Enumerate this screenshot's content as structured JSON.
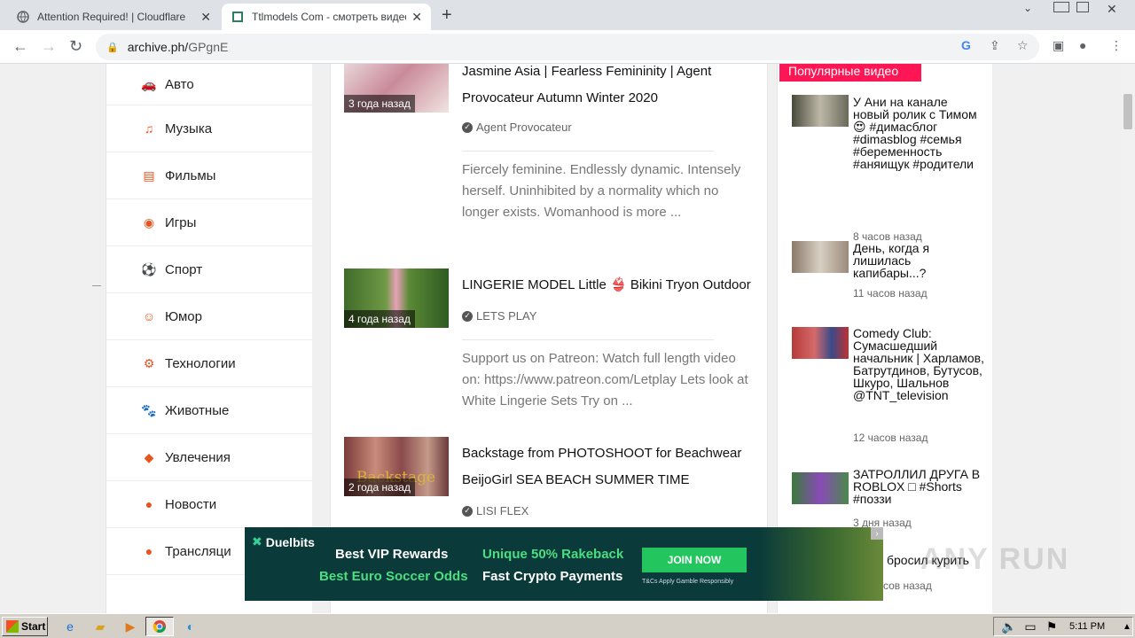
{
  "browser": {
    "tabs": [
      {
        "title": "Attention Required! | Cloudflare",
        "favicon": "globe-icon"
      },
      {
        "title": "Ttlmodels Com - смотреть видео он",
        "favicon": "page-icon"
      }
    ],
    "address": {
      "host": "archive.ph/",
      "path": "GPgnE"
    }
  },
  "sidebar": {
    "items": [
      {
        "label": "Авто",
        "icon": "car-icon"
      },
      {
        "label": "Музыка",
        "icon": "music-icon"
      },
      {
        "label": "Фильмы",
        "icon": "film-icon"
      },
      {
        "label": "Игры",
        "icon": "gamepad-icon"
      },
      {
        "label": "Спорт",
        "icon": "ball-icon"
      },
      {
        "label": "Юмор",
        "icon": "smile-icon"
      },
      {
        "label": "Технологии",
        "icon": "gears-icon"
      },
      {
        "label": "Животные",
        "icon": "paw-icon"
      },
      {
        "label": "Увлечения",
        "icon": "hobby-icon"
      },
      {
        "label": "Новости",
        "icon": "globe-icon"
      },
      {
        "label": "Трансляци",
        "icon": "broadcast-icon"
      }
    ]
  },
  "feed": {
    "items": [
      {
        "ago": "3 года назад",
        "title": "Jasmine Asia | Fearless Femininity | Agent Provocateur Autumn Winter 2020",
        "channel": "Agent Provocateur",
        "description": "Fiercely feminine. Endlessly dynamic. Intensely herself. Uninhibited by a normality which no longer exists. Womanhood is more ..."
      },
      {
        "ago": "4 года назад",
        "title": "LINGERIE MODEL Little 👙 Bikini Tryon Outdoor",
        "channel": "LETS PLAY",
        "description": "Support us on Patreon: Watch full length video on: https://www.patreon.com/Letplay Lets look at White Lingerie Sets Try on ..."
      },
      {
        "ago": "2 года назад",
        "title": "Backstage from PHOTOSHOOT for Beachwear BeijoGirl SEA BEACH SUMMER TIME",
        "channel": "LISI FLEX",
        "thumb_text": "Backstage"
      }
    ]
  },
  "popular": {
    "heading": "Популярные видео",
    "items": [
      {
        "title": "У Ани на канале новый ролик с Тимом😍 #димасблог #dimasblog #семья #беременность #аняищук #родители",
        "ago": "8 часов назад"
      },
      {
        "title": "День, когда я лишилась капибары...?",
        "ago": "11 часов назад"
      },
      {
        "title": "Comedy Club: Сумасшедший начальник | Харламов, Батрутдинов, Бутусов, Шкуро, Шальнов @TNT_television",
        "ago": "12 часов назад"
      },
      {
        "title": "ЗАТРОЛЛИЛ ДРУГА В ROBLOX □ #Shorts #поззи",
        "ago": "3 дня назад"
      }
    ],
    "peek_title": "бросил курить",
    "peek_ago": "сов назад"
  },
  "ad": {
    "brand": "Duelbits",
    "line1": "Best VIP Rewards",
    "line2": "Best Euro Soccer Odds",
    "line3": "Unique 50% Rakeback",
    "line4": "Fast Crypto Payments",
    "cta": "JOIN NOW",
    "small": "T&Cs Apply   Gamble Responsibly"
  },
  "watermark": "ANY RUN",
  "taskbar": {
    "start": "Start",
    "clock": "5:11 PM"
  },
  "colors": {
    "accent": "#e8541e",
    "popular": "#ff1654",
    "ad_bg": "#0b3a3a"
  }
}
